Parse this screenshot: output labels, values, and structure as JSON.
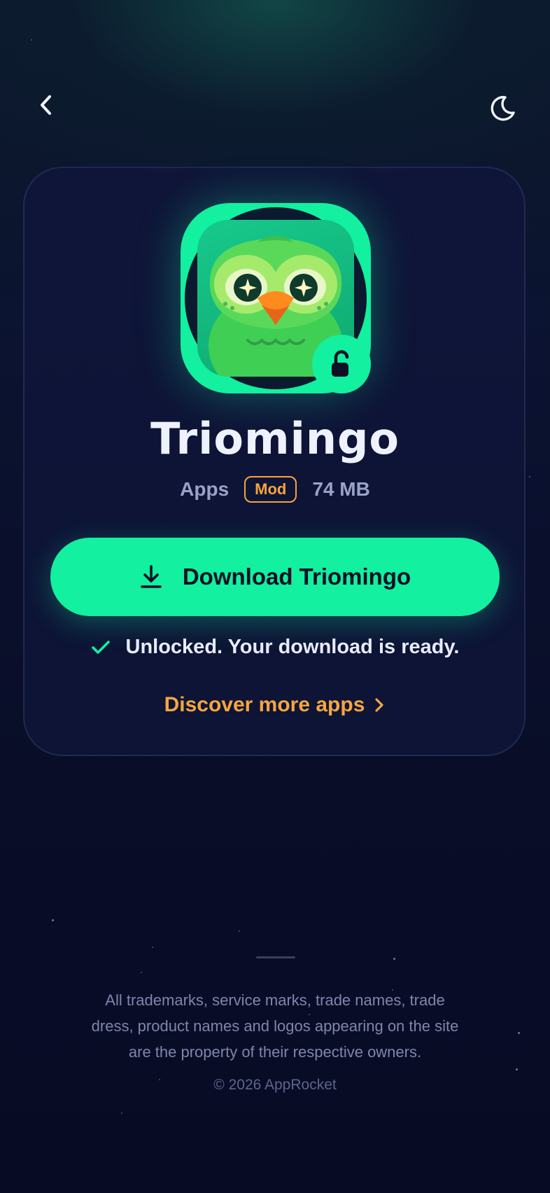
{
  "nav": {
    "back_icon": "chevron-left-icon",
    "theme_icon": "moon-icon"
  },
  "app": {
    "name": "Triomingo",
    "category": "Apps",
    "badge": "Mod",
    "size": "74 MB",
    "icon": "owl-app-icon",
    "status_icon": "unlocked-padlock-icon"
  },
  "download": {
    "label": "Download Triomingo",
    "icon": "download-icon"
  },
  "status": {
    "text": "Unlocked. Your download is ready.",
    "icon": "check-icon"
  },
  "discover": {
    "label": "Discover more apps",
    "icon": "chevron-right-icon"
  },
  "footer": {
    "legal": "All trademarks, service marks, trade names, trade dress, product names and logos appearing on the site are the property of their respective owners.",
    "copyright": "© 2026 AppRocket"
  },
  "colors": {
    "accent": "#12f0a0",
    "highlight": "#f5a540",
    "background": "#0a0e27"
  }
}
